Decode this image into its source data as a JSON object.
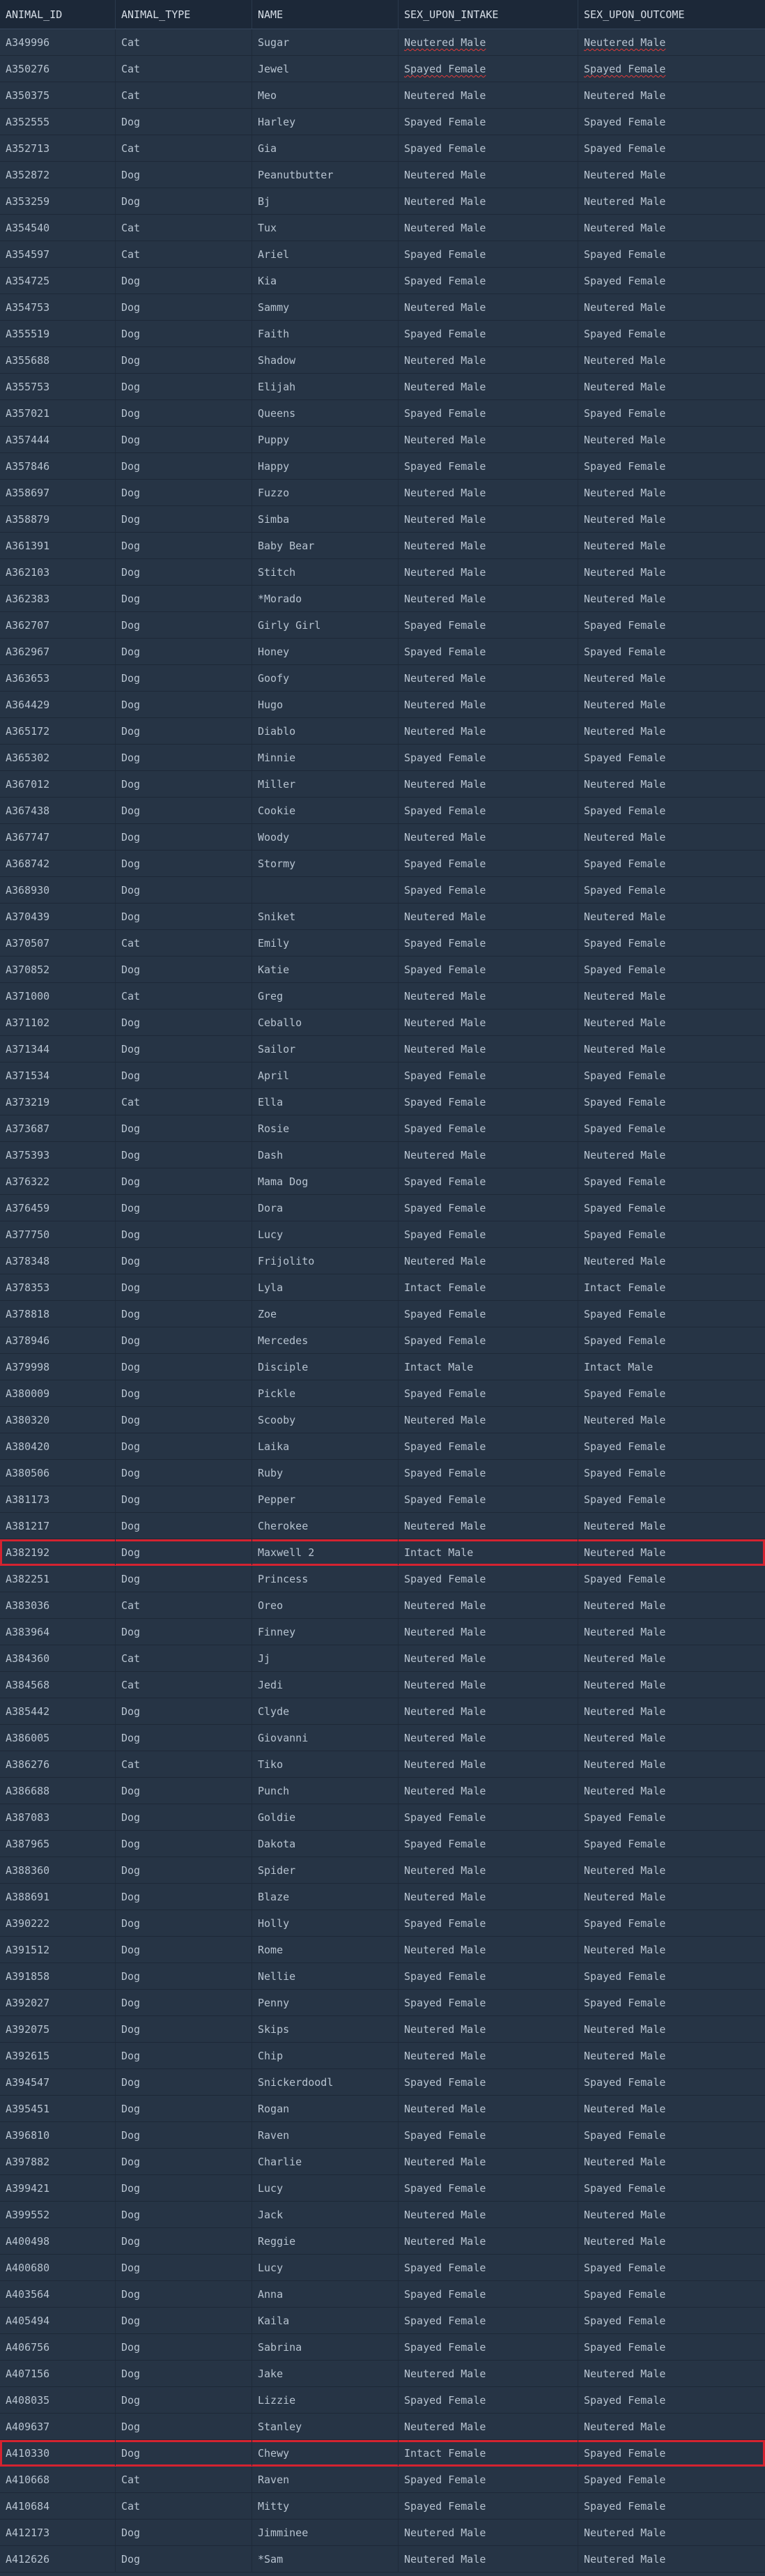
{
  "columns": [
    "ANIMAL_ID",
    "ANIMAL_TYPE",
    "NAME",
    "SEX_UPON_INTAKE",
    "SEX_UPON_OUTCOME"
  ],
  "selected_ids": [
    "A382192",
    "A410330"
  ],
  "spellcheck_ids": [
    "A349996",
    "A350276"
  ],
  "colors": {
    "background": "#263445",
    "header_background": "#1c2838",
    "selection_outline": "#d42330",
    "text": "#b7c3d0"
  },
  "rows": [
    [
      "A349996",
      "Cat",
      "Sugar",
      "Neutered Male",
      "Neutered Male"
    ],
    [
      "A350276",
      "Cat",
      "Jewel",
      "Spayed Female",
      "Spayed Female"
    ],
    [
      "A350375",
      "Cat",
      "Meo",
      "Neutered Male",
      "Neutered Male"
    ],
    [
      "A352555",
      "Dog",
      "Harley",
      "Spayed Female",
      "Spayed Female"
    ],
    [
      "A352713",
      "Cat",
      "Gia",
      "Spayed Female",
      "Spayed Female"
    ],
    [
      "A352872",
      "Dog",
      "Peanutbutter",
      "Neutered Male",
      "Neutered Male"
    ],
    [
      "A353259",
      "Dog",
      "Bj",
      "Neutered Male",
      "Neutered Male"
    ],
    [
      "A354540",
      "Cat",
      "Tux",
      "Neutered Male",
      "Neutered Male"
    ],
    [
      "A354597",
      "Cat",
      "Ariel",
      "Spayed Female",
      "Spayed Female"
    ],
    [
      "A354725",
      "Dog",
      "Kia",
      "Spayed Female",
      "Spayed Female"
    ],
    [
      "A354753",
      "Dog",
      "Sammy",
      "Neutered Male",
      "Neutered Male"
    ],
    [
      "A355519",
      "Dog",
      "Faith",
      "Spayed Female",
      "Spayed Female"
    ],
    [
      "A355688",
      "Dog",
      "Shadow",
      "Neutered Male",
      "Neutered Male"
    ],
    [
      "A355753",
      "Dog",
      "Elijah",
      "Neutered Male",
      "Neutered Male"
    ],
    [
      "A357021",
      "Dog",
      "Queens",
      "Spayed Female",
      "Spayed Female"
    ],
    [
      "A357444",
      "Dog",
      "Puppy",
      "Neutered Male",
      "Neutered Male"
    ],
    [
      "A357846",
      "Dog",
      "Happy",
      "Spayed Female",
      "Spayed Female"
    ],
    [
      "A358697",
      "Dog",
      "Fuzzo",
      "Neutered Male",
      "Neutered Male"
    ],
    [
      "A358879",
      "Dog",
      "Simba",
      "Neutered Male",
      "Neutered Male"
    ],
    [
      "A361391",
      "Dog",
      "Baby Bear",
      "Neutered Male",
      "Neutered Male"
    ],
    [
      "A362103",
      "Dog",
      "Stitch",
      "Neutered Male",
      "Neutered Male"
    ],
    [
      "A362383",
      "Dog",
      "*Morado",
      "Neutered Male",
      "Neutered Male"
    ],
    [
      "A362707",
      "Dog",
      "Girly Girl",
      "Spayed Female",
      "Spayed Female"
    ],
    [
      "A362967",
      "Dog",
      "Honey",
      "Spayed Female",
      "Spayed Female"
    ],
    [
      "A363653",
      "Dog",
      "Goofy",
      "Neutered Male",
      "Neutered Male"
    ],
    [
      "A364429",
      "Dog",
      "Hugo",
      "Neutered Male",
      "Neutered Male"
    ],
    [
      "A365172",
      "Dog",
      "Diablo",
      "Neutered Male",
      "Neutered Male"
    ],
    [
      "A365302",
      "Dog",
      "Minnie",
      "Spayed Female",
      "Spayed Female"
    ],
    [
      "A367012",
      "Dog",
      "Miller",
      "Neutered Male",
      "Neutered Male"
    ],
    [
      "A367438",
      "Dog",
      "Cookie",
      "Spayed Female",
      "Spayed Female"
    ],
    [
      "A367747",
      "Dog",
      "Woody",
      "Neutered Male",
      "Neutered Male"
    ],
    [
      "A368742",
      "Dog",
      "Stormy",
      "Spayed Female",
      "Spayed Female"
    ],
    [
      "A368930",
      "Dog",
      "",
      "Spayed Female",
      "Spayed Female"
    ],
    [
      "A370439",
      "Dog",
      "Sniket",
      "Neutered Male",
      "Neutered Male"
    ],
    [
      "A370507",
      "Cat",
      "Emily",
      "Spayed Female",
      "Spayed Female"
    ],
    [
      "A370852",
      "Dog",
      "Katie",
      "Spayed Female",
      "Spayed Female"
    ],
    [
      "A371000",
      "Cat",
      "Greg",
      "Neutered Male",
      "Neutered Male"
    ],
    [
      "A371102",
      "Dog",
      "Ceballo",
      "Neutered Male",
      "Neutered Male"
    ],
    [
      "A371344",
      "Dog",
      "Sailor",
      "Neutered Male",
      "Neutered Male"
    ],
    [
      "A371534",
      "Dog",
      "April",
      "Spayed Female",
      "Spayed Female"
    ],
    [
      "A373219",
      "Cat",
      "Ella",
      "Spayed Female",
      "Spayed Female"
    ],
    [
      "A373687",
      "Dog",
      "Rosie",
      "Spayed Female",
      "Spayed Female"
    ],
    [
      "A375393",
      "Dog",
      "Dash",
      "Neutered Male",
      "Neutered Male"
    ],
    [
      "A376322",
      "Dog",
      "Mama Dog",
      "Spayed Female",
      "Spayed Female"
    ],
    [
      "A376459",
      "Dog",
      "Dora",
      "Spayed Female",
      "Spayed Female"
    ],
    [
      "A377750",
      "Dog",
      "Lucy",
      "Spayed Female",
      "Spayed Female"
    ],
    [
      "A378348",
      "Dog",
      "Frijolito",
      "Neutered Male",
      "Neutered Male"
    ],
    [
      "A378353",
      "Dog",
      "Lyla",
      "Intact Female",
      "Intact Female"
    ],
    [
      "A378818",
      "Dog",
      "Zoe",
      "Spayed Female",
      "Spayed Female"
    ],
    [
      "A378946",
      "Dog",
      "Mercedes",
      "Spayed Female",
      "Spayed Female"
    ],
    [
      "A379998",
      "Dog",
      "Disciple",
      "Intact Male",
      "Intact Male"
    ],
    [
      "A380009",
      "Dog",
      "Pickle",
      "Spayed Female",
      "Spayed Female"
    ],
    [
      "A380320",
      "Dog",
      "Scooby",
      "Neutered Male",
      "Neutered Male"
    ],
    [
      "A380420",
      "Dog",
      "Laika",
      "Spayed Female",
      "Spayed Female"
    ],
    [
      "A380506",
      "Dog",
      "Ruby",
      "Spayed Female",
      "Spayed Female"
    ],
    [
      "A381173",
      "Dog",
      "Pepper",
      "Spayed Female",
      "Spayed Female"
    ],
    [
      "A381217",
      "Dog",
      "Cherokee",
      "Neutered Male",
      "Neutered Male"
    ],
    [
      "A382192",
      "Dog",
      "Maxwell 2",
      "Intact Male",
      "Neutered Male"
    ],
    [
      "A382251",
      "Dog",
      "Princess",
      "Spayed Female",
      "Spayed Female"
    ],
    [
      "A383036",
      "Cat",
      "Oreo",
      "Neutered Male",
      "Neutered Male"
    ],
    [
      "A383964",
      "Dog",
      "Finney",
      "Neutered Male",
      "Neutered Male"
    ],
    [
      "A384360",
      "Cat",
      "Jj",
      "Neutered Male",
      "Neutered Male"
    ],
    [
      "A384568",
      "Cat",
      "Jedi",
      "Neutered Male",
      "Neutered Male"
    ],
    [
      "A385442",
      "Dog",
      "Clyde",
      "Neutered Male",
      "Neutered Male"
    ],
    [
      "A386005",
      "Dog",
      "Giovanni",
      "Neutered Male",
      "Neutered Male"
    ],
    [
      "A386276",
      "Cat",
      "Tiko",
      "Neutered Male",
      "Neutered Male"
    ],
    [
      "A386688",
      "Dog",
      "Punch",
      "Neutered Male",
      "Neutered Male"
    ],
    [
      "A387083",
      "Dog",
      "Goldie",
      "Spayed Female",
      "Spayed Female"
    ],
    [
      "A387965",
      "Dog",
      "Dakota",
      "Spayed Female",
      "Spayed Female"
    ],
    [
      "A388360",
      "Dog",
      "Spider",
      "Neutered Male",
      "Neutered Male"
    ],
    [
      "A388691",
      "Dog",
      "Blaze",
      "Neutered Male",
      "Neutered Male"
    ],
    [
      "A390222",
      "Dog",
      "Holly",
      "Spayed Female",
      "Spayed Female"
    ],
    [
      "A391512",
      "Dog",
      "Rome",
      "Neutered Male",
      "Neutered Male"
    ],
    [
      "A391858",
      "Dog",
      "Nellie",
      "Spayed Female",
      "Spayed Female"
    ],
    [
      "A392027",
      "Dog",
      "Penny",
      "Spayed Female",
      "Spayed Female"
    ],
    [
      "A392075",
      "Dog",
      "Skips",
      "Neutered Male",
      "Neutered Male"
    ],
    [
      "A392615",
      "Dog",
      "Chip",
      "Neutered Male",
      "Neutered Male"
    ],
    [
      "A394547",
      "Dog",
      "Snickerdoodl",
      "Spayed Female",
      "Spayed Female"
    ],
    [
      "A395451",
      "Dog",
      "Rogan",
      "Neutered Male",
      "Neutered Male"
    ],
    [
      "A396810",
      "Dog",
      "Raven",
      "Spayed Female",
      "Spayed Female"
    ],
    [
      "A397882",
      "Dog",
      "Charlie",
      "Neutered Male",
      "Neutered Male"
    ],
    [
      "A399421",
      "Dog",
      "Lucy",
      "Spayed Female",
      "Spayed Female"
    ],
    [
      "A399552",
      "Dog",
      "Jack",
      "Neutered Male",
      "Neutered Male"
    ],
    [
      "A400498",
      "Dog",
      "Reggie",
      "Neutered Male",
      "Neutered Male"
    ],
    [
      "A400680",
      "Dog",
      "Lucy",
      "Spayed Female",
      "Spayed Female"
    ],
    [
      "A403564",
      "Dog",
      "Anna",
      "Spayed Female",
      "Spayed Female"
    ],
    [
      "A405494",
      "Dog",
      "Kaila",
      "Spayed Female",
      "Spayed Female"
    ],
    [
      "A406756",
      "Dog",
      "Sabrina",
      "Spayed Female",
      "Spayed Female"
    ],
    [
      "A407156",
      "Dog",
      "Jake",
      "Neutered Male",
      "Neutered Male"
    ],
    [
      "A408035",
      "Dog",
      "Lizzie",
      "Spayed Female",
      "Spayed Female"
    ],
    [
      "A409637",
      "Dog",
      "Stanley",
      "Neutered Male",
      "Neutered Male"
    ],
    [
      "A410330",
      "Dog",
      "Chewy",
      "Intact Female",
      "Spayed Female"
    ],
    [
      "A410668",
      "Cat",
      "Raven",
      "Spayed Female",
      "Spayed Female"
    ],
    [
      "A410684",
      "Cat",
      "Mitty",
      "Spayed Female",
      "Spayed Female"
    ],
    [
      "A412173",
      "Dog",
      "Jimminee",
      "Neutered Male",
      "Neutered Male"
    ],
    [
      "A412626",
      "Dog",
      "*Sam",
      "Neutered Male",
      "Neutered Male"
    ]
  ]
}
